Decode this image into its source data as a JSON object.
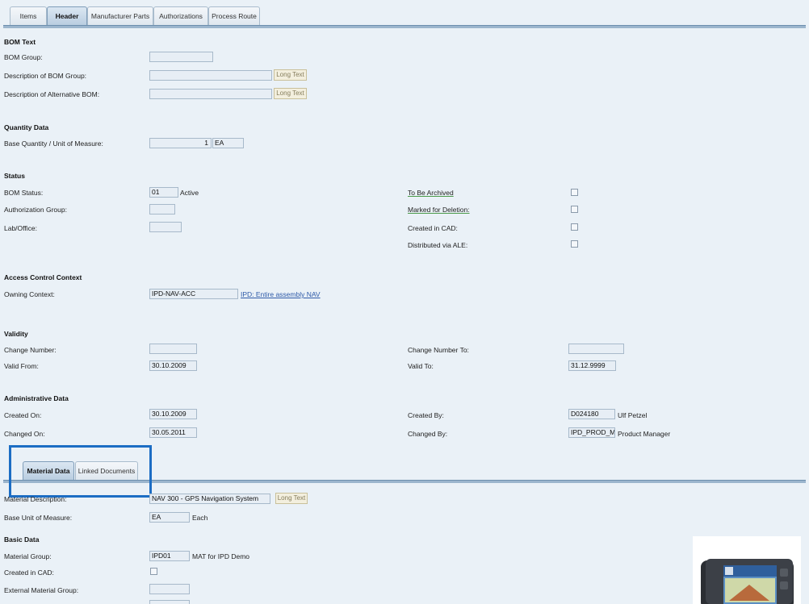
{
  "tabs": [
    {
      "label": "Items",
      "active": false
    },
    {
      "label": "Header",
      "active": true
    },
    {
      "label": "Manufacturer Parts",
      "active": false
    },
    {
      "label": "Authorizations",
      "active": false
    },
    {
      "label": "Process Route",
      "active": false
    }
  ],
  "bom_text": {
    "title": "BOM Text",
    "bom_group_label": "BOM Group:",
    "bom_group_value": "",
    "desc_group_label": "Description of BOM Group:",
    "desc_group_value": "",
    "desc_alt_label": "Description of Alternative BOM:",
    "desc_alt_value": "",
    "long_text": "Long Text"
  },
  "quantity": {
    "title": "Quantity Data",
    "base_label": "Base Quantity / Unit of Measure:",
    "base_qty": "1",
    "base_uom": "EA"
  },
  "status": {
    "title": "Status",
    "bom_status_label": "BOM Status:",
    "bom_status_value": "01",
    "bom_status_text": "Active",
    "auth_group_label": "Authorization Group:",
    "auth_group_value": "",
    "lab_office_label": "Lab/Office:",
    "lab_office_value": "",
    "to_be_archived_label": "To Be Archived",
    "marked_deletion_label": "Marked for Deletion:",
    "created_cad_label": "Created in CAD:",
    "distributed_ale_label": "Distributed via ALE:"
  },
  "access": {
    "title": "Access Control Context",
    "owning_label": "Owning Context:",
    "owning_value": "IPD-NAV-ACC",
    "owning_link": "IPD: Entire assembly NAV"
  },
  "validity": {
    "title": "Validity",
    "change_number_label": "Change Number:",
    "change_number_value": "",
    "change_number_to_label": "Change Number To:",
    "change_number_to_value": "",
    "valid_from_label": "Valid From:",
    "valid_from_value": "30.10.2009",
    "valid_to_label": "Valid To:",
    "valid_to_value": "31.12.9999"
  },
  "admin": {
    "title": "Administrative Data",
    "created_on_label": "Created On:",
    "created_on_value": "30.10.2009",
    "created_by_label": "Created By:",
    "created_by_value": "D024180",
    "created_by_name": "Ulf Petzel",
    "changed_on_label": "Changed On:",
    "changed_on_value": "30.05.2011",
    "changed_by_label": "Changed By:",
    "changed_by_value": "IPD_PROD_MGR",
    "changed_by_name": "Product Manager"
  },
  "subtabs": [
    {
      "label": "Material Data",
      "active": true
    },
    {
      "label": "Linked Documents",
      "active": false
    }
  ],
  "material": {
    "desc_label": "Material Description:",
    "desc_value": "NAV 300 - GPS Navigation System",
    "long_text": "Long Text",
    "base_uom_label": "Base Unit of Measure:",
    "base_uom_value": "EA",
    "base_uom_text": "Each"
  },
  "basic": {
    "title": "Basic Data",
    "mat_group_label": "Material Group:",
    "mat_group_value": "IPD01",
    "mat_group_text": "MAT for IPD Demo",
    "created_cad_label": "Created in CAD:",
    "ext_group_label": "External Material Group:",
    "ext_group_value": ""
  },
  "colors": {
    "background": "#eaf1f7",
    "highlight": "#1c6dc4",
    "link": "#2e5aa8"
  }
}
